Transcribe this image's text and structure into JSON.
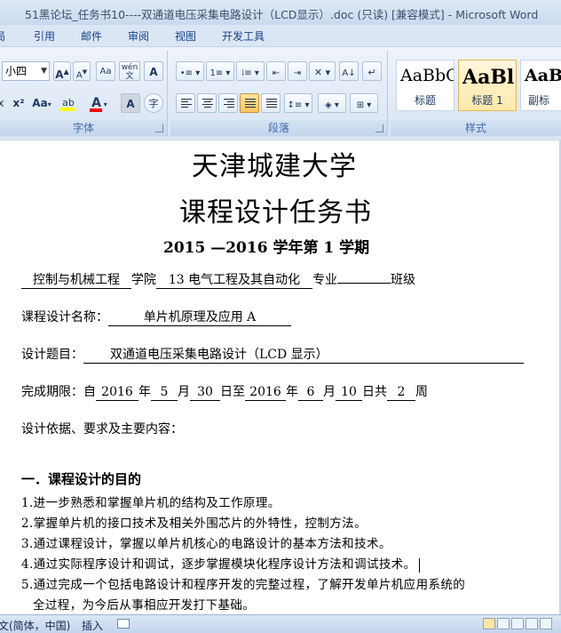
{
  "window": {
    "title": "51黑论坛_任务书10----双通道电压采集电路设计（LCD显示）.doc (只读) [兼容模式] - Microsoft Word"
  },
  "ribbon": {
    "tabs": [
      "局",
      "引用",
      "邮件",
      "审阅",
      "视图",
      "开发工具"
    ],
    "font": {
      "size_value": "小四",
      "grow_label": "A",
      "shrink_label": "A",
      "clear_label": "Aa",
      "phonetic_label": "wén",
      "border_label": "A",
      "subscript_label": "x",
      "superscript_label": "x²",
      "case_label": "Aa",
      "highlight_label": "ab",
      "color_label": "A",
      "shade_label": "A",
      "enclose_label": "字",
      "group_label": "字体"
    },
    "paragraph": {
      "group_label": "段落"
    },
    "styles": {
      "group_label": "样式",
      "items": [
        {
          "sample": "AaBbC",
          "name": "标题"
        },
        {
          "sample": "AaBl",
          "name": "标题 1"
        },
        {
          "sample": "AaB",
          "name": "副标"
        }
      ]
    },
    "colors": {
      "highlight": "#ffff00",
      "font_color": "#ff0000"
    }
  },
  "document": {
    "title1": "天津城建大学",
    "title2": "课程设计任务书",
    "term": "2015 —2016 学年第  1 学期",
    "college_row": {
      "college": "控制与机械工程",
      "college_suffix": "学院",
      "major": "13 电气工程及其自动化",
      "major_suffix": "专业",
      "class_suffix": "班级"
    },
    "course_name": {
      "label": "课程设计名称：",
      "value": "单片机原理及应用 A"
    },
    "topic": {
      "label": "设计题目：",
      "value": "双通道电压采集电路设计（LCD 显示）"
    },
    "deadline": {
      "label": "完成期限：自",
      "y1": "2016",
      "t_year1": "年",
      "m1": "5",
      "t_month1": "月",
      "d1": "30",
      "t_day1": "日至",
      "y2": "2016",
      "t_year2": "年",
      "m2": "6",
      "t_month2": "月",
      "d2": "10",
      "t_day2": "日共",
      "weeks": "2",
      "t_weeks": "周"
    },
    "basis": "设计依据、要求及主要内容：",
    "section1": "一．课程设计的目的",
    "items": [
      "1.进一步熟悉和掌握单片机的结构及工作原理。",
      "2.掌握单片机的接口技术及相关外围芯片的外特性，控制方法。",
      "3.通过课程设计，掌握以单片机核心的电路设计的基本方法和技术。",
      "4.通过实际程序设计和调试，逐步掌握模块化程序设计方法和调试技术。",
      "5.通过完成一个包括电路设计和程序开发的完整过程，了解开发单片机应用系统的",
      "全过程，为今后从事相应开发打下基础。"
    ]
  },
  "statusbar": {
    "language": "文(简体，中国)",
    "mode": "插入"
  }
}
